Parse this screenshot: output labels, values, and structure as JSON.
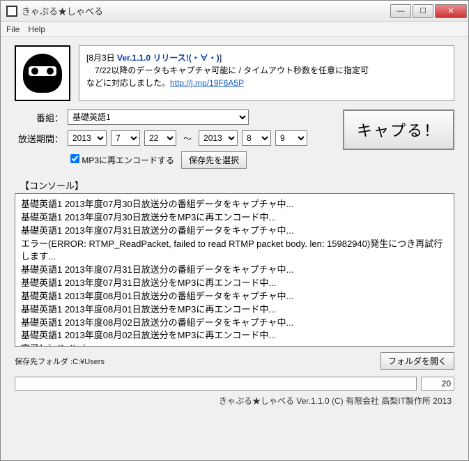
{
  "window": {
    "title": "きゃぷる★しゃべる"
  },
  "menu": {
    "file": "File",
    "help": "Help"
  },
  "notice": {
    "date": "[8月3日 ",
    "version": "Ver.1.1.0 リリース!(・∀・)",
    "bracket_close": "]",
    "line1": "　7/22以降のデータもキャプチャ可能に / タイムアウト秒数を任意に指定可",
    "line2_pre": "などに対応しました。",
    "link": "http://j.mp/19F6A5P"
  },
  "form": {
    "program_label": "番組：",
    "program_value": "基礎英語1",
    "period_label": "放送期間：",
    "from_year": "2013",
    "from_month": "7",
    "from_day": "22",
    "to_year": "2013",
    "to_month": "8",
    "to_day": "9",
    "tilde": "～",
    "capture_btn": "キャプる！",
    "mp3_checkbox": "MP3に再エンコードする",
    "save_dest_btn": "保存先を選択"
  },
  "console": {
    "label": "【コンソール】",
    "lines": [
      "基礎英語1 2013年度07月30日放送分の番組データをキャプチャ中...",
      "基礎英語1 2013年度07月30日放送分をMP3に再エンコード中...",
      "基礎英語1 2013年度07月31日放送分の番組データをキャプチャ中...",
      "エラー(ERROR: RTMP_ReadPacket, failed to read RTMP packet body. len: 15982940)発生につき再試行します...",
      "基礎英語1 2013年度07月31日放送分の番組データをキャプチャ中...",
      "基礎英語1 2013年度07月31日放送分をMP3に再エンコード中...",
      "基礎英語1 2013年度08月01日放送分の番組データをキャプチャ中...",
      "基礎英語1 2013年度08月01日放送分をMP3に再エンコード中...",
      "基礎英語1 2013年度08月02日放送分の番組データをキャプチャ中...",
      "基礎英語1 2013年度08月02日放送分をMP3に再エンコード中...",
      "完了！＼(^o^)／"
    ]
  },
  "bottom": {
    "save_path_label": "保存先フォルダ :C:¥Users",
    "open_folder_btn": "フォルダを開く",
    "progress_pct": "20"
  },
  "footer": {
    "text": "きゃぷる★しゃべる Ver.1.1.0 (C) 有限会社 高梨IT製作所 2013"
  }
}
